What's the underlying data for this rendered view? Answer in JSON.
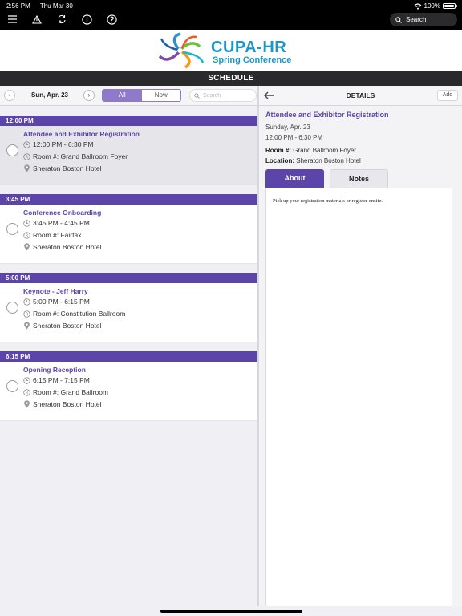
{
  "status_bar": {
    "time": "2:56 PM",
    "date": "Thu Mar 30",
    "battery": "100%"
  },
  "toolbar": {
    "icons": [
      "menu-icon",
      "alert-icon",
      "sync-icon",
      "info-icon",
      "help-icon"
    ],
    "search_label": "Search"
  },
  "banner": {
    "logo_title": "CUPA-HR",
    "logo_subtitle": "Spring Conference"
  },
  "schedule": {
    "header": "SCHEDULE",
    "date": "Sun, Apr. 23",
    "filters": [
      "All",
      "Now"
    ],
    "active_filter": "All",
    "search_placeholder": "Search",
    "groups": [
      {
        "time": "12:00 PM",
        "items": [
          {
            "title": "Attendee and Exhibitor Registration",
            "time_range": "12:00 PM - 6:30 PM",
            "room": "Room #: Grand Ballroom Foyer",
            "location": "Sheraton Boston Hotel",
            "selected": true
          }
        ]
      },
      {
        "time": "3:45 PM",
        "items": [
          {
            "title": "Conference Onboarding",
            "time_range": "3:45 PM - 4:45 PM",
            "room": "Room #: Fairfax",
            "location": "Sheraton Boston Hotel"
          }
        ]
      },
      {
        "time": "5:00 PM",
        "items": [
          {
            "title": "Keynote - Jeff Harry",
            "time_range": "5:00 PM - 6:15 PM",
            "room": "Room #: Constitution Ballroom",
            "location": "Sheraton Boston Hotel"
          }
        ]
      },
      {
        "time": "6:15 PM",
        "items": [
          {
            "title": "Opening Reception",
            "time_range": "6:15 PM - 7:15 PM",
            "room": "Room #: Grand Ballroom",
            "location": "Sheraton Boston Hotel"
          }
        ]
      }
    ]
  },
  "details": {
    "header": "DETAILS",
    "add_label": "Add",
    "title": "Attendee and Exhibitor Registration",
    "date": "Sunday, Apr. 23",
    "time_range": "12:00 PM - 6:30 PM",
    "room_label": "Room #:",
    "room_value": "Grand Ballroom Foyer",
    "location_label": "Location:",
    "location_value": "Sheraton Boston Hotel",
    "tabs": [
      "About",
      "Notes"
    ],
    "about_text": "Pick up your registration materials or register onsite."
  },
  "colors": {
    "accent": "#5b45a8",
    "segment": "#8e7ac8",
    "brand_blue": "#1d95c9"
  }
}
